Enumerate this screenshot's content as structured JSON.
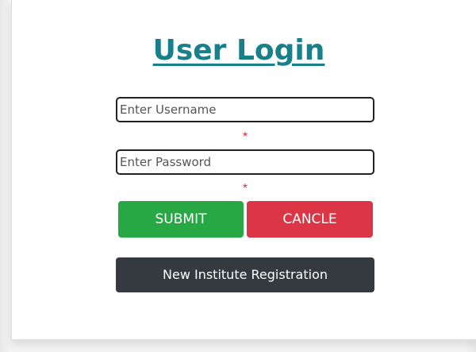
{
  "login": {
    "title": "User Login",
    "username": {
      "placeholder": "Enter Username",
      "value": ""
    },
    "password": {
      "placeholder": "Enter Password",
      "value": ""
    },
    "required_marker": "*",
    "submit_label": "SUBMIT",
    "cancel_label": "CANCLE",
    "register_label": "New Institute Registration"
  },
  "colors": {
    "title": "#17808a",
    "submit": "#28a745",
    "cancel": "#dc3545",
    "register": "#343a40",
    "required": "#e0303a"
  }
}
